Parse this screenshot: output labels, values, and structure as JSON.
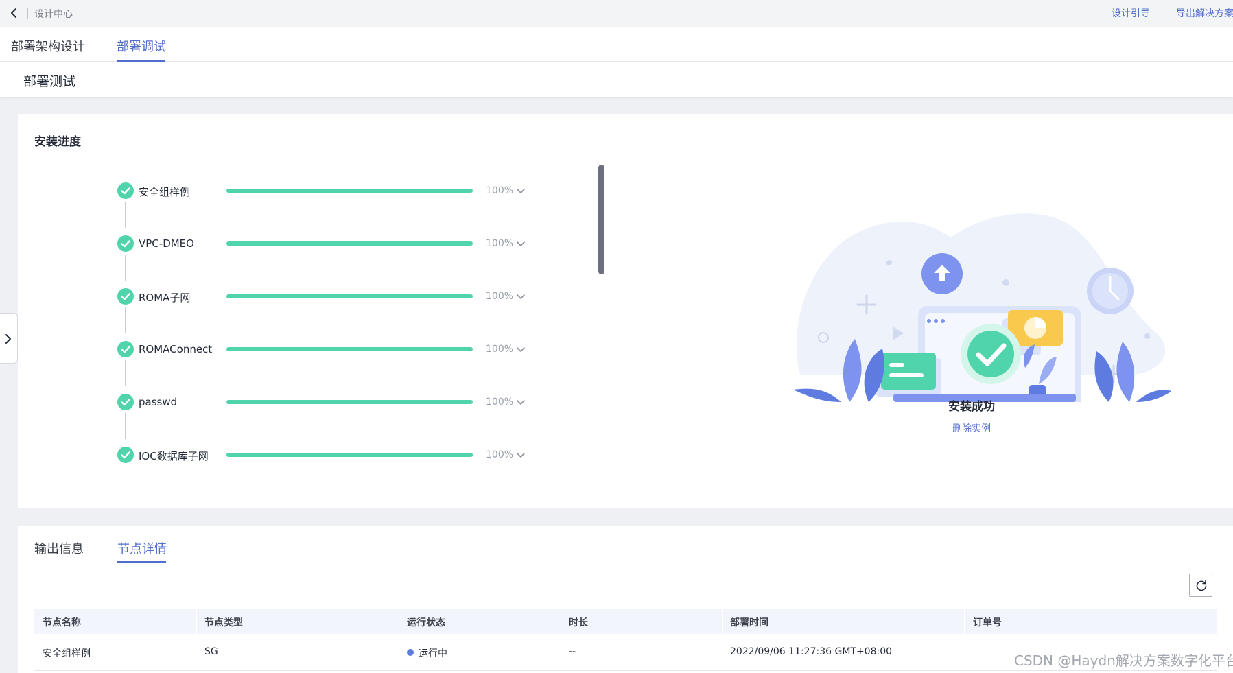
{
  "topbar": {
    "breadcrumb": "设计中心",
    "links": {
      "guide": "设计引导",
      "export": "导出解决方案"
    }
  },
  "main_tabs": [
    {
      "label": "部署架构设计",
      "active": false
    },
    {
      "label": "部署调试",
      "active": true
    }
  ],
  "subheader": {
    "title": "部署测试"
  },
  "progress": {
    "title": "安装进度",
    "steps": [
      {
        "label": "安全组样例",
        "percent_text": "100%",
        "progress": 1.0
      },
      {
        "label": "VPC-DMEO",
        "percent_text": "100%",
        "progress": 1.0
      },
      {
        "label": "ROMA子网",
        "percent_text": "100%",
        "progress": 1.0
      },
      {
        "label": "ROMAConnect",
        "percent_text": "100%",
        "progress": 1.0
      },
      {
        "label": "passwd",
        "percent_text": "100%",
        "progress": 1.0
      },
      {
        "label": "IOC数据库子网",
        "percent_text": "100%",
        "progress": 1.0
      }
    ],
    "result": {
      "status": "安装成功",
      "action": "删除实例"
    }
  },
  "detail_tabs": [
    {
      "label": "输出信息",
      "active": false
    },
    {
      "label": "节点详情",
      "active": true
    }
  ],
  "table": {
    "headers": [
      "节点名称",
      "节点类型",
      "运行状态",
      "时长",
      "部署时间",
      "订单号"
    ],
    "rows": [
      {
        "name": "安全组样例",
        "type": "SG",
        "status": "运行中",
        "duration": "--",
        "deployed_at": "2022/09/06 11:27:36 GMT+08:00",
        "order_no": ""
      }
    ]
  },
  "watermark": "CSDN @Haydn解决方案数字化平台",
  "colors": {
    "accent": "#526ecc",
    "success": "#50d4ab",
    "running": "#5e7ce0"
  }
}
